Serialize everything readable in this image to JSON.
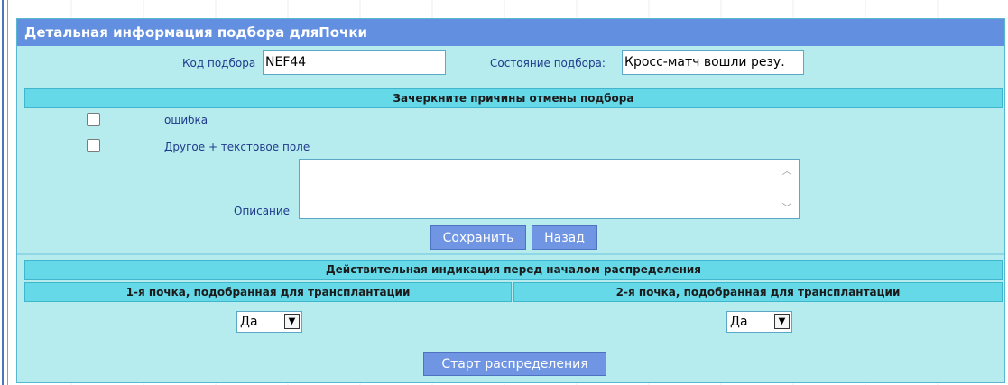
{
  "panel": {
    "title": "Детальная информация подбора дляПочки"
  },
  "match_code": {
    "label": "Код подбора",
    "value": "NEF44"
  },
  "match_state": {
    "label": "Состояние подбора:",
    "value": "Кросс-матч вошли резу."
  },
  "cancel_reasons": {
    "header": "Зачеркните причины отмены подбора",
    "items": [
      {
        "label": "ошибка",
        "checked": false
      },
      {
        "label": "Другое + текстовое поле",
        "checked": false
      }
    ],
    "description_label": "Описание",
    "description_value": ""
  },
  "buttons": {
    "save": "Сохранить",
    "back": "Назад",
    "start": "Старт распределения"
  },
  "indication": {
    "header": "Действительная индикация перед началом распределения",
    "col1_header": "1-я почка, подобранная для трансплантации",
    "col2_header": "2-я почка, подобранная для трансплантации",
    "col1_value": "Да",
    "col2_value": "Да"
  },
  "colors": {
    "title_bar": "#638fe0",
    "panel_bg": "#b7ecef",
    "section_header": "#66d9e8",
    "button": "#6f95e3"
  }
}
